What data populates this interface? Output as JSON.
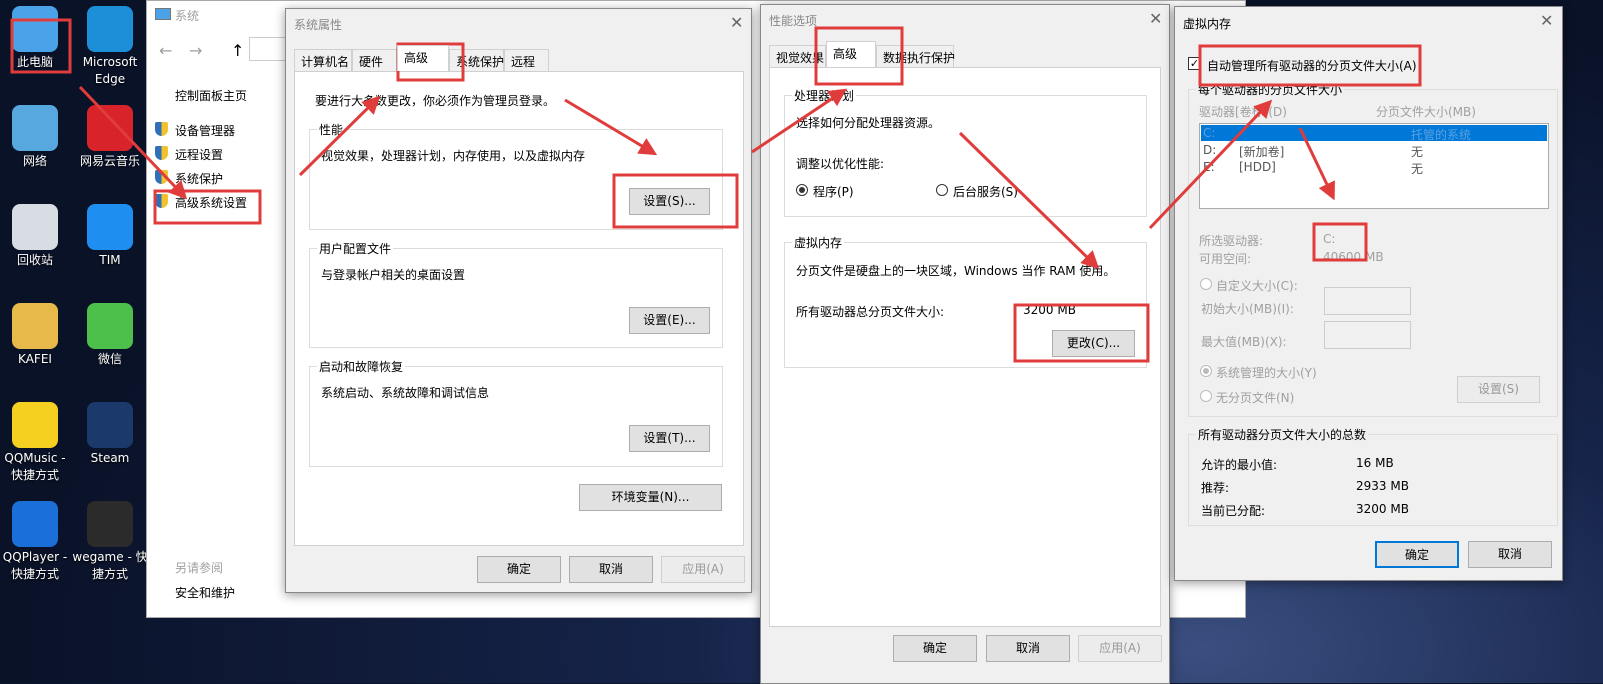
{
  "desktop": {
    "icons": [
      {
        "label": "此电脑",
        "color": "#4aa3e8"
      },
      {
        "label": "Microsoft Edge",
        "color": "#1d8fd8"
      },
      {
        "label": "网络",
        "color": "#58a8e0"
      },
      {
        "label": "网易云音乐",
        "color": "#d8232a"
      },
      {
        "label": "回收站",
        "color": "#d8dde3"
      },
      {
        "label": "TIM",
        "color": "#1e8ef0"
      },
      {
        "label": "KAFEI",
        "color": "#e6b94a"
      },
      {
        "label": "微信",
        "color": "#4cc04b"
      },
      {
        "label": "QQMusic - 快捷方式",
        "color": "#f5d020"
      },
      {
        "label": "Steam",
        "color": "#1b3a6b"
      },
      {
        "label": "QQPlayer - 快捷方式",
        "color": "#1a6fd8"
      },
      {
        "label": "wegame - 快捷方式",
        "color": "#2b2b2b"
      }
    ]
  },
  "system_window": {
    "title": "系统",
    "sidebar": {
      "home": "控制面板主页",
      "items": [
        "设备管理器",
        "远程设置",
        "系统保护",
        "高级系统设置"
      ],
      "see_also": "另请参阅",
      "see_also_link": "安全和维护"
    }
  },
  "sys_props": {
    "title": "系统属性",
    "tabs": [
      "计算机名",
      "硬件",
      "高级",
      "系统保护",
      "远程"
    ],
    "selected_tab": "高级",
    "admin_note": "要进行大多数更改，你必须作为管理员登录。",
    "groups": [
      {
        "legend": "性能",
        "desc": "视觉效果，处理器计划，内存使用，以及虚拟内存",
        "button": "设置(S)..."
      },
      {
        "legend": "用户配置文件",
        "desc": "与登录帐户相关的桌面设置",
        "button": "设置(E)..."
      },
      {
        "legend": "启动和故障恢复",
        "desc": "系统启动、系统故障和调试信息",
        "button": "设置(T)..."
      }
    ],
    "env_button": "环境变量(N)...",
    "ok": "确定",
    "cancel": "取消",
    "apply": "应用(A)"
  },
  "perf": {
    "title": "性能选项",
    "tabs": [
      "视觉效果",
      "高级",
      "数据执行保护"
    ],
    "selected_tab": "高级",
    "cpu": {
      "legend": "处理器计划",
      "desc": "选择如何分配处理器资源。",
      "adjust": "调整以优化性能:",
      "opt1": "程序(P)",
      "opt2": "后台服务(S)",
      "selected": "程序(P)"
    },
    "vm": {
      "legend": "虚拟内存",
      "desc": "分页文件是硬盘上的一块区域，Windows 当作 RAM 使用。",
      "total_label": "所有驱动器总分页文件大小:",
      "total_value": "3200 MB",
      "change": "更改(C)..."
    },
    "ok": "确定",
    "cancel": "取消",
    "apply": "应用(A)"
  },
  "vmem": {
    "title": "虚拟内存",
    "auto_label": "自动管理所有驱动器的分页文件大小(A)",
    "auto_checked": true,
    "per_drive_legend": "每个驱动器的分页文件大小",
    "col_drive": "驱动器[卷标](D)",
    "col_size": "分页文件大小(MB)",
    "drives": [
      {
        "drive": "C:",
        "label": "",
        "size": "托管的系统",
        "selected": true
      },
      {
        "drive": "D:",
        "label": "[新加卷]",
        "size": "无"
      },
      {
        "drive": "E:",
        "label": "[HDD]",
        "size": "无"
      }
    ],
    "selected_drive_label": "所选驱动器:",
    "selected_drive": "C:",
    "free_label": "可用空间:",
    "free_value": "40600 MB",
    "custom": "自定义大小(C):",
    "initial": "初始大小(MB)(I):",
    "max": "最大值(MB)(X):",
    "system_managed": "系统管理的大小(Y)",
    "no_paging": "无分页文件(N)",
    "set": "设置(S)",
    "totals_legend": "所有驱动器分页文件大小的总数",
    "min_label": "允许的最小值:",
    "min_value": "16 MB",
    "rec_label": "推荐:",
    "rec_value": "2933 MB",
    "cur_label": "当前已分配:",
    "cur_value": "3200 MB",
    "ok": "确定",
    "cancel": "取消"
  },
  "annotation_color": "#e03c3c"
}
